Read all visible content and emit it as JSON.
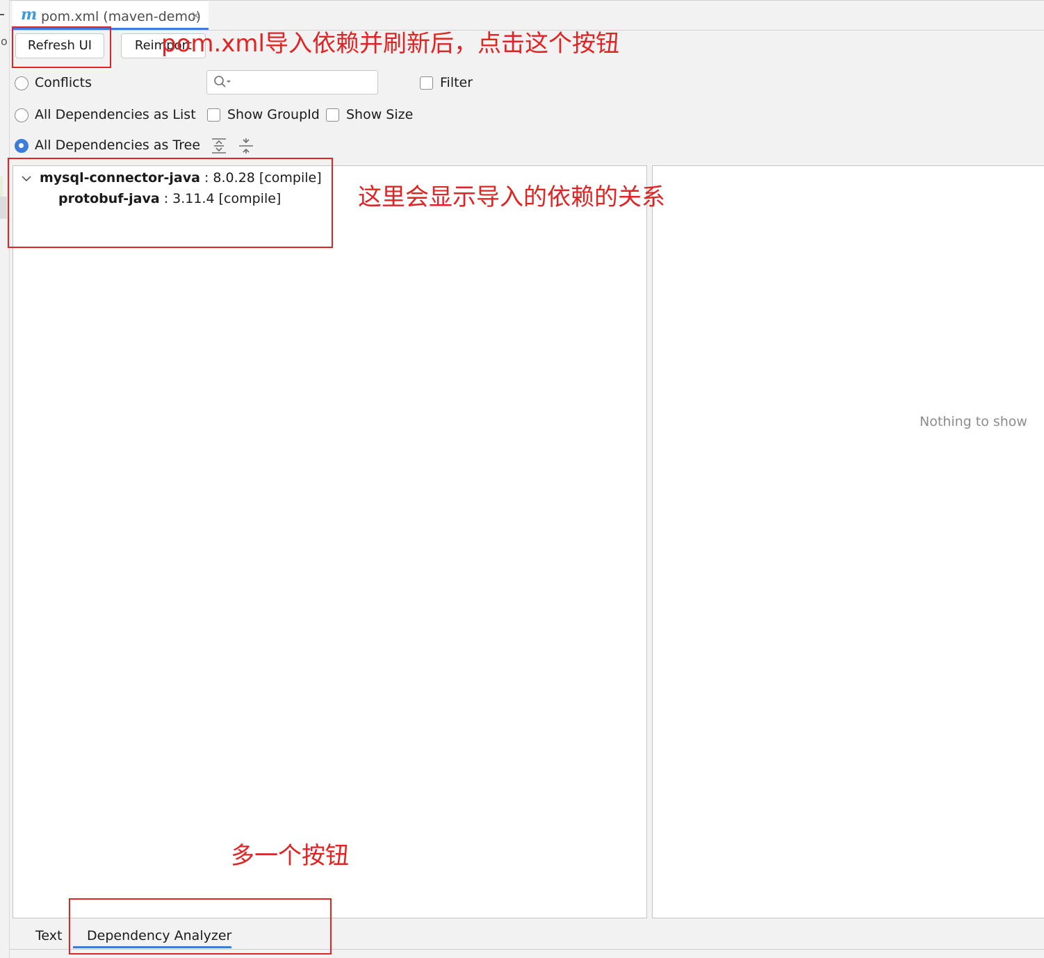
{
  "editor_tab": {
    "icon": "m",
    "title": "pom.xml (maven-demo)",
    "close": "×"
  },
  "gutter": {
    "letter": "o"
  },
  "toolbar": {
    "refresh_label": "Refresh UI",
    "reimport_label": "Reimport"
  },
  "view_modes": {
    "conflicts": "Conflicts",
    "as_list": "All Dependencies as List",
    "as_tree": "All Dependencies as Tree",
    "selected": "as_tree"
  },
  "options": {
    "filter": "Filter",
    "show_groupid": "Show GroupId",
    "show_size": "Show Size"
  },
  "search": {
    "value": "",
    "placeholder": ""
  },
  "tree": {
    "root": {
      "name": "mysql-connector-java",
      "meta": " : 8.0.28 [compile]"
    },
    "child": {
      "name": "protobuf-java",
      "meta": " : 3.11.4 [compile]"
    }
  },
  "details": {
    "empty_text": "Nothing to show"
  },
  "bottom_tabs": {
    "text": "Text",
    "analyzer": "Dependency Analyzer",
    "active": "analyzer"
  },
  "annotations": {
    "refresh_note": "pom.xml导入依赖并刷新后，点击这个按钮",
    "tree_note": "这里会显示导入的依赖的关系",
    "tab_note": "多一个按钮",
    "color": "#e02424"
  },
  "colors": {
    "accent": "#3d7dd8",
    "maven_icon": "#3d9bd8"
  }
}
